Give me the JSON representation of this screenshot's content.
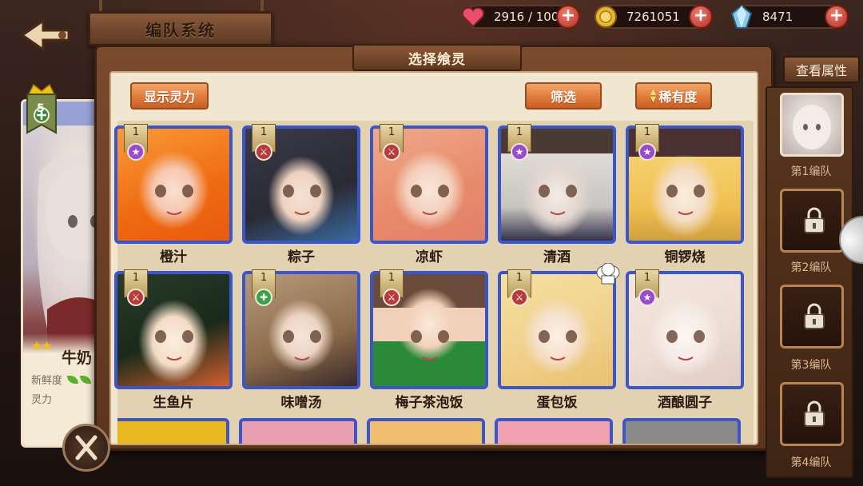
{
  "header": {
    "title": "编队系统",
    "resources": [
      {
        "name": "stamina",
        "value": "2916 / 100",
        "icon": "heart-icon",
        "color": "#e8506a"
      },
      {
        "name": "gold",
        "value": "7261051",
        "icon": "coin-icon",
        "color": "#e6b830"
      },
      {
        "name": "crystal",
        "value": "8471",
        "icon": "crystal-icon",
        "color": "#7ab8d8"
      }
    ]
  },
  "left_card": {
    "rank": "5",
    "name": "牛奶",
    "stars": "★★",
    "freshness_label": "新鲜度",
    "power_label": "灵力"
  },
  "panel": {
    "title": "选择飨灵",
    "show_power_btn": "显示灵力",
    "filter_btn": "筛选",
    "rarity_btn": "稀有度"
  },
  "cards": [
    {
      "name": "橙汁",
      "level": "1",
      "element": "star",
      "elem_color": "#9a4ad0",
      "art": "orange"
    },
    {
      "name": "粽子",
      "level": "1",
      "element": "sword",
      "elem_color": "#b83a3a",
      "art": "darkhair"
    },
    {
      "name": "凉虾",
      "level": "1",
      "element": "sword",
      "elem_color": "#b83a3a",
      "art": "peach"
    },
    {
      "name": "清酒",
      "level": "1",
      "element": "star",
      "elem_color": "#9a4ad0",
      "art": "silver"
    },
    {
      "name": "铜锣烧",
      "level": "1",
      "element": "star",
      "elem_color": "#9a4ad0",
      "art": "blonde"
    },
    {
      "name": "生鱼片",
      "level": "1",
      "element": "sword",
      "elem_color": "#b83a3a",
      "art": "greenhair"
    },
    {
      "name": "味噌汤",
      "level": "1",
      "element": "cross",
      "elem_color": "#3aa24a",
      "art": "brownlong"
    },
    {
      "name": "梅子茶泡饭",
      "level": "1",
      "element": "sword",
      "elem_color": "#b83a3a",
      "art": "green"
    },
    {
      "name": "蛋包饭",
      "level": "1",
      "element": "sword",
      "elem_color": "#b83a3a",
      "art": "cream",
      "chef": true
    },
    {
      "name": "酒酿圆子",
      "level": "1",
      "element": "star",
      "elem_color": "#9a4ad0",
      "art": "white"
    }
  ],
  "sidebar": {
    "attr_btn": "查看属性",
    "teams": [
      "第1编队",
      "第2编队",
      "第3编队",
      "第4编队"
    ]
  }
}
